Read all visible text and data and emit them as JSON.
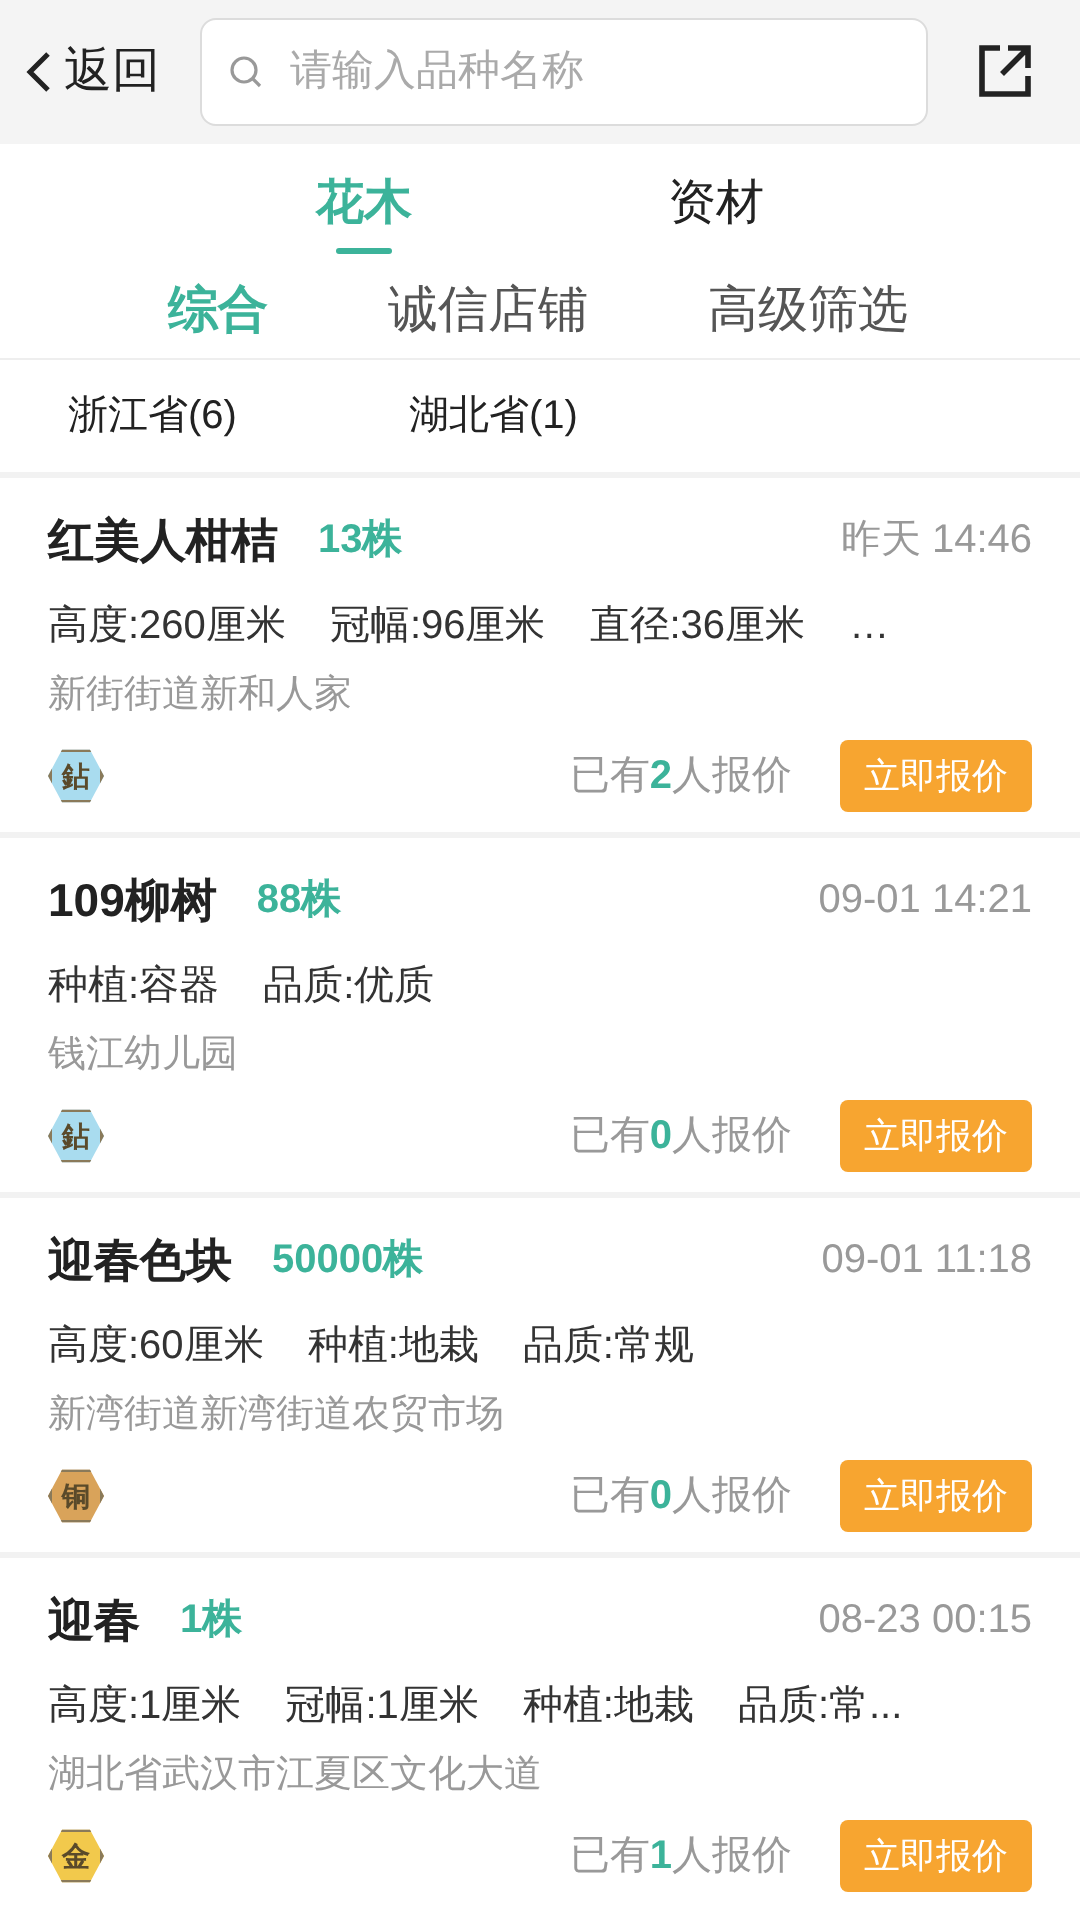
{
  "header": {
    "back_label": "返回",
    "search": {
      "placeholder": "请输入品种名称"
    }
  },
  "tabs": [
    {
      "label": "花木",
      "selected": true
    },
    {
      "label": "资材",
      "selected": false
    }
  ],
  "sort_tabs": [
    {
      "label": "综合",
      "selected": true
    },
    {
      "label": "诚信店铺",
      "selected": false
    },
    {
      "label": "高级筛选",
      "selected": false
    }
  ],
  "provinces": [
    "浙江省(6)",
    "湖北省(1)"
  ],
  "listings": [
    {
      "name": "红美人柑桔",
      "quantity": "13株",
      "time": "昨天 14:46",
      "specs": [
        "高度:260厘米",
        "冠幅:96厘米",
        "直径:36厘米",
        "…"
      ],
      "address": "新街街道新和人家",
      "badge": {
        "text": "鉆",
        "color": "#a9dcef"
      },
      "quotes": "已有**2**人报价",
      "action": "立即报价"
    },
    {
      "name": "109柳树",
      "quantity": "88株",
      "time": "09-01 14:21",
      "specs": [
        "种植:容器",
        "品质:优质"
      ],
      "address": "钱江幼儿园",
      "badge": {
        "text": "鉆",
        "color": "#a9dcef"
      },
      "quotes": "已有**0**人报价",
      "action": "立即报价"
    },
    {
      "name": "迎春色块",
      "quantity": "50000株",
      "time": "09-01 11:18",
      "specs": [
        "高度:60厘米",
        "种植:地栽",
        "品质:常规"
      ],
      "address": "新湾街道新湾街道农贸市场",
      "badge": {
        "text": "铜",
        "color": "#d9a35a"
      },
      "quotes": "已有**0**人报价",
      "action": "立即报价"
    },
    {
      "name": "迎春",
      "quantity": "1株",
      "time": "08-23 00:15",
      "specs": [
        "高度:1厘米",
        "冠幅:1厘米",
        "种植:地栽",
        "品质:常..."
      ],
      "address": "湖北省武汉市江夏区文化大道",
      "badge": {
        "text": "金",
        "color": "#f2c94c"
      },
      "quotes": "已有**1**人报价",
      "action": "立即报价"
    }
  ]
}
